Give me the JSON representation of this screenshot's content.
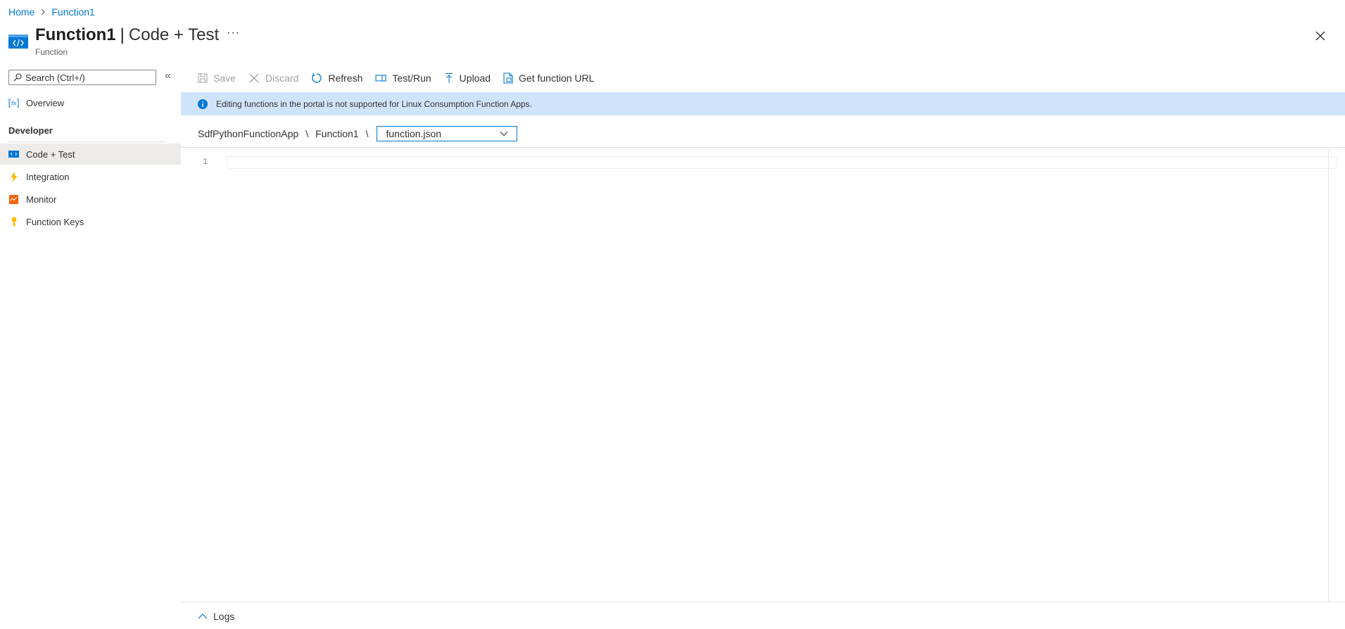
{
  "breadcrumb": {
    "home": "Home",
    "current": "Function1"
  },
  "header": {
    "title_bold": "Function1",
    "title_separator": "|",
    "title_sub": "Code + Test",
    "more": "···",
    "resource_type": "Function"
  },
  "sidebar": {
    "search_placeholder": "Search (Ctrl+/)",
    "collapse": "«",
    "overview": "Overview",
    "section": "Developer",
    "items": [
      {
        "label": "Code + Test",
        "icon": "code-icon",
        "active": true
      },
      {
        "label": "Integration",
        "icon": "lightning-icon"
      },
      {
        "label": "Monitor",
        "icon": "monitor-icon"
      },
      {
        "label": "Function Keys",
        "icon": "key-icon"
      }
    ]
  },
  "toolbar": {
    "save": "Save",
    "discard": "Discard",
    "refresh": "Refresh",
    "test_run": "Test/Run",
    "upload": "Upload",
    "get_url": "Get function URL"
  },
  "banner": {
    "text": "Editing functions in the portal is not supported for Linux Consumption Function Apps."
  },
  "path": {
    "app": "SdfPythonFunctionApp",
    "separator": "\\",
    "function": "Function1",
    "file": "function.json"
  },
  "editor": {
    "line_number": "1"
  },
  "logs": {
    "label": "Logs"
  },
  "colors": {
    "accent": "#0078d4",
    "banner_bg": "#cfe4fa",
    "active_nav_bg": "#edebe9",
    "icon_orange": "#f25022",
    "icon_yellow": "#ffb900"
  }
}
